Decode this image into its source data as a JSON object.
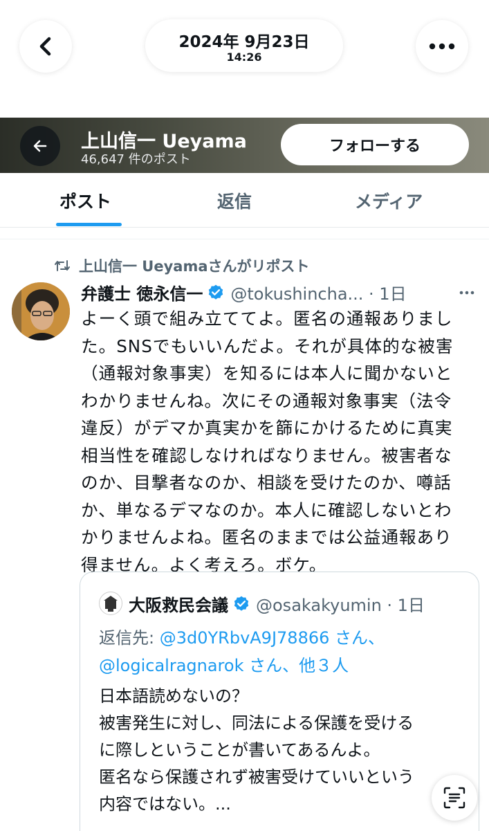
{
  "viewer": {
    "date": "2024年 9月23日",
    "time": "14:26",
    "back_icon": "chevron-left-icon",
    "more_icon": "ellipsis-icon"
  },
  "profile": {
    "name": "上山信一 Ueyama",
    "post_count": "46,647 件のポスト",
    "follow_label": "フォローする"
  },
  "tabs": [
    {
      "label": "ポスト",
      "active": true
    },
    {
      "label": "返信",
      "active": false
    },
    {
      "label": "メディア",
      "active": false
    }
  ],
  "tweet": {
    "repost_text": "上山信一 Ueyamaさんがリポスト",
    "author_name": "弁護士 徳永信一",
    "author_handle": "@tokushincha... · 1日",
    "body_lines": [
      "よーく頭で組み立ててよ。匿名の通報ありまし",
      "た。SNSでもいいんだよ。それが具体的な被害",
      "（通報対象事実）を知るには本人に聞かないと",
      "わかりませんね。次にその通報対象事実（法令",
      "違反）がデマか真実かを篩にかけるために真実",
      "相当性を確認しなければなりません。被害者な",
      "のか、目撃者なのか、相談を受けたのか、噂話",
      "か、単なるデマなのか。本人に確認しないとわ",
      "かりませんよね。匿名のままでは公益通報あり",
      "得ません。よく考えろ。ボケ。"
    ]
  },
  "quote": {
    "author_name": "大阪救民会議",
    "author_handle": "@osakakyumin · 1日",
    "reply_prefix": "返信先: ",
    "reply_link1": "@3d0YRbvA9J78866",
    "reply_mid1": " さん、",
    "reply_link2": "@logicalragnarok",
    "reply_mid2": " さん、",
    "reply_others": "他３人",
    "body_lines": [
      "日本語読めないの？",
      "被害発生に対し、同法による保護を受ける",
      "に際しということが書いてあるんよ。",
      "匿名なら保護されず被害受けていいという",
      "内容ではない。..."
    ]
  },
  "colors": {
    "accent": "#1d9bf0",
    "text": "#0f1419",
    "secondary": "#536471"
  }
}
